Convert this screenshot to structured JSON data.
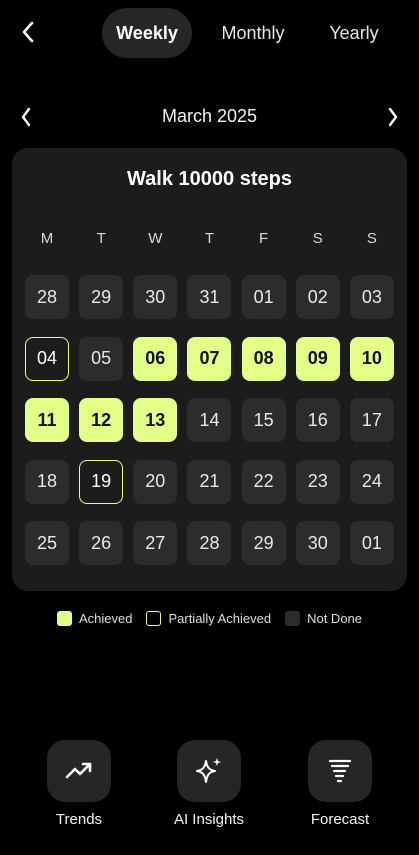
{
  "header": {
    "tabs": [
      {
        "label": "Weekly",
        "active": true
      },
      {
        "label": "Monthly",
        "active": false
      },
      {
        "label": "Yearly",
        "active": false
      }
    ]
  },
  "month_nav": {
    "label": "March 2025"
  },
  "calendar": {
    "title": "Walk 10000 steps",
    "weekdays": [
      "M",
      "T",
      "W",
      "T",
      "F",
      "S",
      "S"
    ],
    "days": [
      {
        "label": "28",
        "status": "notdone"
      },
      {
        "label": "29",
        "status": "notdone"
      },
      {
        "label": "30",
        "status": "notdone"
      },
      {
        "label": "31",
        "status": "notdone"
      },
      {
        "label": "01",
        "status": "notdone"
      },
      {
        "label": "02",
        "status": "notdone"
      },
      {
        "label": "03",
        "status": "notdone"
      },
      {
        "label": "04",
        "status": "partial"
      },
      {
        "label": "05",
        "status": "notdone"
      },
      {
        "label": "06",
        "status": "achieved"
      },
      {
        "label": "07",
        "status": "achieved"
      },
      {
        "label": "08",
        "status": "achieved"
      },
      {
        "label": "09",
        "status": "achieved"
      },
      {
        "label": "10",
        "status": "achieved"
      },
      {
        "label": "11",
        "status": "achieved"
      },
      {
        "label": "12",
        "status": "achieved"
      },
      {
        "label": "13",
        "status": "achieved"
      },
      {
        "label": "14",
        "status": "notdone"
      },
      {
        "label": "15",
        "status": "notdone"
      },
      {
        "label": "16",
        "status": "notdone"
      },
      {
        "label": "17",
        "status": "notdone"
      },
      {
        "label": "18",
        "status": "notdone"
      },
      {
        "label": "19",
        "status": "partial"
      },
      {
        "label": "20",
        "status": "notdone"
      },
      {
        "label": "21",
        "status": "notdone"
      },
      {
        "label": "22",
        "status": "notdone"
      },
      {
        "label": "23",
        "status": "notdone"
      },
      {
        "label": "24",
        "status": "notdone"
      },
      {
        "label": "25",
        "status": "notdone"
      },
      {
        "label": "26",
        "status": "notdone"
      },
      {
        "label": "27",
        "status": "notdone"
      },
      {
        "label": "28",
        "status": "notdone"
      },
      {
        "label": "29",
        "status": "notdone"
      },
      {
        "label": "30",
        "status": "notdone"
      },
      {
        "label": "01",
        "status": "notdone"
      }
    ]
  },
  "legend": [
    {
      "label": "Achieved",
      "status": "achieved"
    },
    {
      "label": "Partially Achieved",
      "status": "partial"
    },
    {
      "label": "Not Done",
      "status": "notdone"
    }
  ],
  "actions": [
    {
      "label": "Trends",
      "icon": "trending-up-icon"
    },
    {
      "label": "AI Insights",
      "icon": "sparkles-icon"
    },
    {
      "label": "Forecast",
      "icon": "tornado-icon"
    }
  ],
  "colors": {
    "accent": "#e4ff87",
    "background": "#000000",
    "card": "#1c1c1c",
    "tile": "#2c2c2c"
  }
}
